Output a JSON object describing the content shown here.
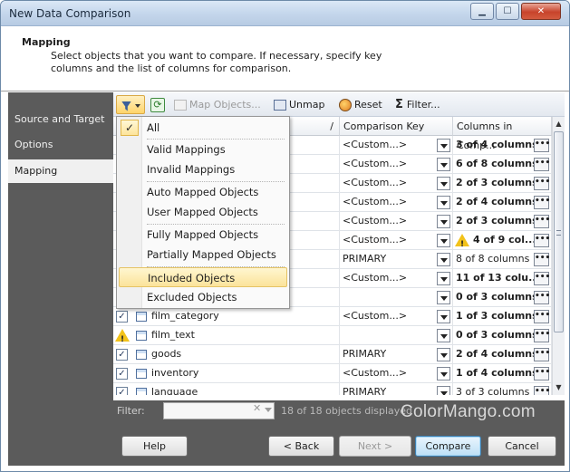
{
  "window": {
    "title": "New Data Comparison"
  },
  "header": {
    "title": "Mapping",
    "description": "Select objects that you want to compare. If necessary, specify key columns and the list of columns for comparison."
  },
  "sidebar": {
    "items": [
      {
        "label": "Source and Target"
      },
      {
        "label": "Options"
      },
      {
        "label": "Mapping",
        "active": true
      }
    ]
  },
  "toolbar": {
    "map": "Map Objects...",
    "unmap": "Unmap",
    "reset": "Reset",
    "filter": "Filter..."
  },
  "grid": {
    "columns": [
      "/",
      "Comparison Key",
      "Columns in Comp..."
    ],
    "rows": [
      {
        "name": "",
        "key": "<Custom...>",
        "cols": "3 of 4 columns",
        "bold": true
      },
      {
        "name": "",
        "key": "<Custom...>",
        "cols": "6 of 8 columns",
        "bold": true
      },
      {
        "name": "",
        "key": "<Custom...>",
        "cols": "2 of 3 columns",
        "bold": true
      },
      {
        "name": "",
        "key": "<Custom...>",
        "cols": "2 of 4 columns",
        "bold": true
      },
      {
        "name": "",
        "key": "<Custom...>",
        "cols": "2 of 3 columns",
        "bold": true
      },
      {
        "name": "",
        "key": "<Custom...>",
        "cols": "4 of 9 col...",
        "bold": true,
        "warn": true
      },
      {
        "name": "",
        "key": "PRIMARY",
        "cols": "8 of 8 columns",
        "bold": false
      },
      {
        "name": "",
        "key": "<Custom...>",
        "cols": "11 of 13 colu...",
        "bold": true
      },
      {
        "name": "",
        "key": "",
        "cols": "0 of 3 columns",
        "bold": true
      },
      {
        "name": "film_category",
        "key": "<Custom...>",
        "cols": "1 of 3 columns",
        "bold": true,
        "check": "checked"
      },
      {
        "name": "film_text",
        "key": "",
        "cols": "0 of 3 columns",
        "bold": true,
        "check": "warn"
      },
      {
        "name": "goods",
        "key": "PRIMARY",
        "cols": "2 of 4 columns",
        "bold": true,
        "check": "checked"
      },
      {
        "name": "inventory",
        "key": "<Custom...>",
        "cols": "1 of 4 columns",
        "bold": true,
        "check": "checked"
      },
      {
        "name": "language",
        "key": "PRIMARY",
        "cols": "3 of 3 columns",
        "bold": false,
        "check": "checked"
      }
    ]
  },
  "filter_menu": {
    "items": [
      "All",
      "Valid Mappings",
      "Invalid Mappings",
      "Auto Mapped Objects",
      "User Mapped Objects",
      "Fully Mapped Objects",
      "Partially Mapped Objects",
      "Included Objects",
      "Excluded Objects"
    ],
    "checked": "All",
    "highlighted": "Included Objects"
  },
  "filterbar": {
    "label": "Filter:",
    "value": "",
    "count": "18 of 18 objects displayed"
  },
  "footer": {
    "help": "Help",
    "back": "< Back",
    "next": "Next >",
    "compare": "Compare",
    "cancel": "Cancel"
  },
  "watermark": "ColorMango.com"
}
